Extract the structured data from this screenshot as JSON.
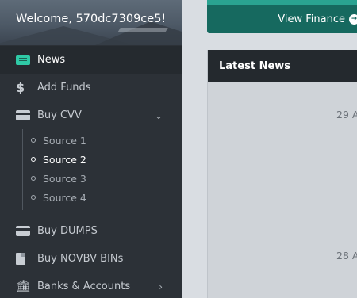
{
  "sidebar": {
    "welcome": "Welcome, 570dc7309ce5!",
    "items": [
      {
        "label": "News",
        "icon": "newspaper-icon",
        "active": true
      },
      {
        "label": "Add Funds",
        "icon": "dollar-icon"
      },
      {
        "label": "Buy CVV",
        "icon": "credit-card-icon",
        "expanded": true
      }
    ],
    "cvv_sources": [
      "Source 1",
      "Source 2",
      "Source 3",
      "Source 4"
    ],
    "selected_source": "Source 2",
    "items_after": [
      {
        "label": "Buy DUMPS",
        "icon": "credit-card-icon"
      },
      {
        "label": "Buy NOVBV BINs",
        "icon": "file-icon"
      },
      {
        "label": "Banks & Accounts",
        "icon": "bank-icon"
      }
    ]
  },
  "header": {
    "finance_button": "View Finance"
  },
  "news": {
    "title": "Latest News",
    "dates": [
      "29 A",
      "28 A"
    ]
  },
  "colors": {
    "sidebar_bg": "#2c3137",
    "accent": "#16695f",
    "news_icon": "#2fc9a6",
    "panel_header": "#24292e"
  }
}
